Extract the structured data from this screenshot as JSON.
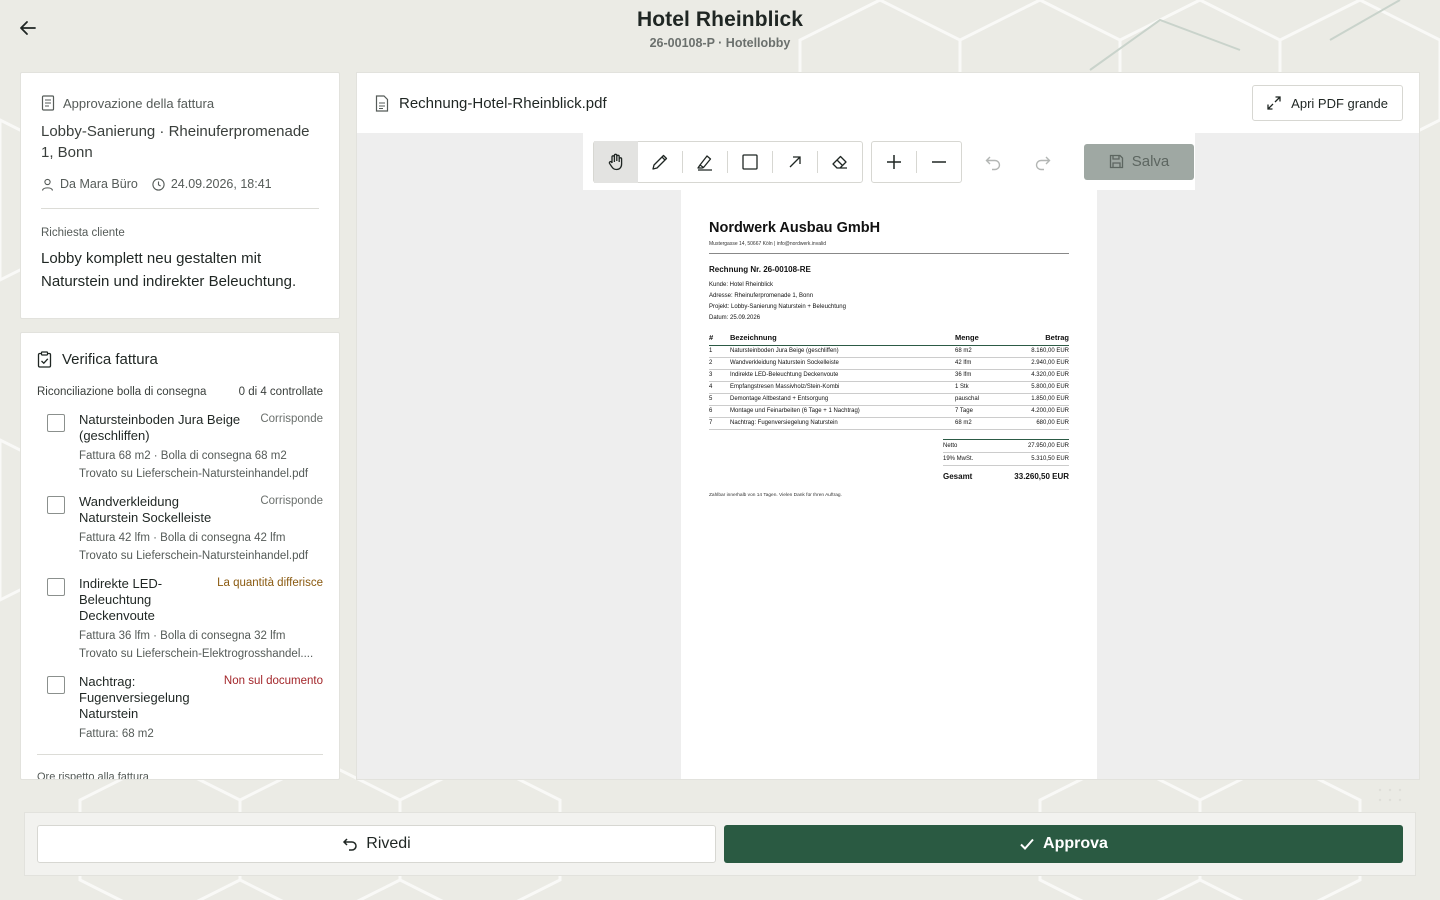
{
  "header": {
    "title": "Hotel Rheinblick",
    "subtitle": "26-00108-P · Hotellobby"
  },
  "approval": {
    "label": "Approvazione della fattura",
    "project": "Lobby-Sanierung · Rheinuferpromenade 1, Bonn",
    "author": "Da Mara Büro",
    "datetime": "24.09.2026, 18:41",
    "request_label": "Richiesta cliente",
    "request_text": "Lobby komplett neu gestalten mit Naturstein und indirekter Beleuchtung."
  },
  "verify": {
    "title": "Verifica fattura",
    "recon_label": "Riconciliazione bolla di consegna",
    "recon_count": "0 di 4 controllate",
    "items": [
      {
        "name": "Natursteinboden Jura Beige (geschliffen)",
        "status": "Corrisponde",
        "detail": "Fattura 68 m2 · Bolla di consegna 68 m2",
        "found": "Trovato su Lieferschein-Natursteinhandel.pdf"
      },
      {
        "name": "Wandverkleidung Naturstein Sockelleiste",
        "status": "Corrisponde",
        "detail": "Fattura 42 lfm · Bolla di consegna 42 lfm",
        "found": "Trovato su Lieferschein-Natursteinhandel.pdf"
      },
      {
        "name": "Indirekte LED-Beleuchtung Deckenvoute",
        "status": "La quantità differisce",
        "detail": "Fattura 36 lfm · Bolla di consegna 32 lfm",
        "found": "Trovato su Lieferschein-Elektrogrosshandel...."
      },
      {
        "name": "Nachtrag: Fugenversiegelung Naturstein",
        "status": "Non sul documento",
        "detail": "Fattura: 68 m2"
      }
    ],
    "hours_label": "Ore rispetto alla fattura"
  },
  "document": {
    "filename": "Rechnung-Hotel-Rheinblick.pdf",
    "open_label": "Apri PDF grande",
    "save_label": "Salva"
  },
  "pdf": {
    "company": "Nordwerk Ausbau GmbH",
    "address": "Mustergasse 14, 50667 Köln | info@nordwerk.invalid",
    "invoice_no": "Rechnung Nr. 26-00108-RE",
    "info": [
      "Kunde: Hotel Rheinblick",
      "Adresse: Rheinuferpromenade 1, Bonn",
      "Projekt: Lobby-Sanierung Naturstein + Beleuchtung",
      "Datum: 25.09.2026"
    ],
    "columns": [
      "#",
      "Bezeichnung",
      "Menge",
      "Betrag"
    ],
    "rows": [
      [
        "1",
        "Natursteinboden Jura Beige (geschliffen)",
        "68 m2",
        "8.160,00 EUR"
      ],
      [
        "2",
        "Wandverkleidung Naturstein Sockelleiste",
        "42 lfm",
        "2.940,00 EUR"
      ],
      [
        "3",
        "Indirekte LED-Beleuchtung Deckenvoute",
        "36 lfm",
        "4.320,00 EUR"
      ],
      [
        "4",
        "Empfangstresen Massivholz/Stein-Kombi",
        "1 Stk",
        "5.800,00 EUR"
      ],
      [
        "5",
        "Demontage Altbestand + Entsorgung",
        "pauschal",
        "1.850,00 EUR"
      ],
      [
        "6",
        "Montage und Feinarbeiten (6 Tage + 1 Nachtrag)",
        "7 Tage",
        "4.200,00 EUR"
      ],
      [
        "7",
        "Nachtrag: Fugenversiegelung Naturstein",
        "68 m2",
        "680,00 EUR"
      ]
    ],
    "netto_label": "Netto",
    "netto": "27.950,00 EUR",
    "vat_label": "19% MwSt.",
    "vat": "5.310,50 EUR",
    "total_label": "Gesamt",
    "total": "33.260,50 EUR",
    "footer": "Zahlbar innerhalb von 14 Tagen. Vielen Dank für Ihren Auftrag."
  },
  "actions": {
    "revise_label": "Rivedi",
    "approve_label": "Approva"
  },
  "colors": {
    "accent": "#2a5a42",
    "warn": "#8a5a10",
    "error": "#a3262a"
  }
}
